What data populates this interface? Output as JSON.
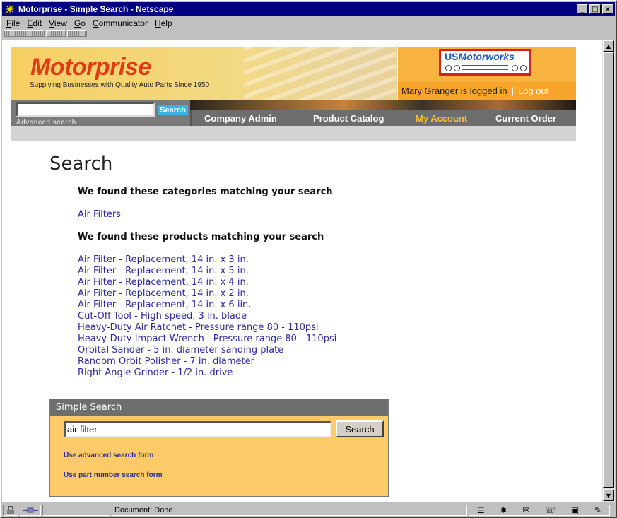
{
  "window": {
    "title": "Motorprise - Simple Search - Netscape"
  },
  "menubar": {
    "items": [
      "File",
      "Edit",
      "View",
      "Go",
      "Communicator",
      "Help"
    ]
  },
  "header": {
    "logo": "Motorprise",
    "tagline": "Supplying Businesses with Quality Auto Parts Since 1950",
    "partner_logo_us": "US",
    "partner_logo_rest": "Motorworks",
    "user_status": "Mary Granger is logged in",
    "separator": "|",
    "logout_label": "Log out"
  },
  "top_search": {
    "button_label": "Search",
    "advanced_link": "Advanced search",
    "value": ""
  },
  "nav": {
    "items": [
      "Company Admin",
      "Product Catalog",
      "My Account",
      "Current Order"
    ],
    "active": "My Account"
  },
  "main": {
    "title": "Search",
    "categories_heading": "We found these categories matching your search",
    "categories": [
      "Air Filters"
    ],
    "products_heading": "We found these products matching your search",
    "products": [
      "Air Filter - Replacement, 14 in. x 3 in.",
      "Air Filter - Replacement, 14 in. x 5 in.",
      "Air Filter - Replacement, 14 in. x 4 in.",
      "Air Filter - Replacement, 14 in. x 2 in.",
      "Air Filter - Replacement, 14 in. x 6 iin.",
      "Cut-Off Tool - High speed, 3 in. blade",
      "Heavy-Duty Air Ratchet - Pressure range 80 - 110psi",
      "Heavy-Duty Impact Wrench - Pressure range 80 - 110psi",
      "Orbital Sander - 5 in. diameter sanding plate",
      "Random Orbit Polisher - 7 in. diameter",
      "Right Angle Grinder - 1/2 in. drive"
    ]
  },
  "simple_search": {
    "heading": "Simple Search",
    "value": "air filter",
    "button_label": "Search",
    "advanced_link": "Use advanced search form",
    "part_number_link": "Use part number search form"
  },
  "statusbar": {
    "text": "Document: Done"
  },
  "colors": {
    "brand_red": "#e23a15",
    "link": "#2a2a9a",
    "active_nav": "#fbbc31",
    "title_bar": "#000080"
  }
}
